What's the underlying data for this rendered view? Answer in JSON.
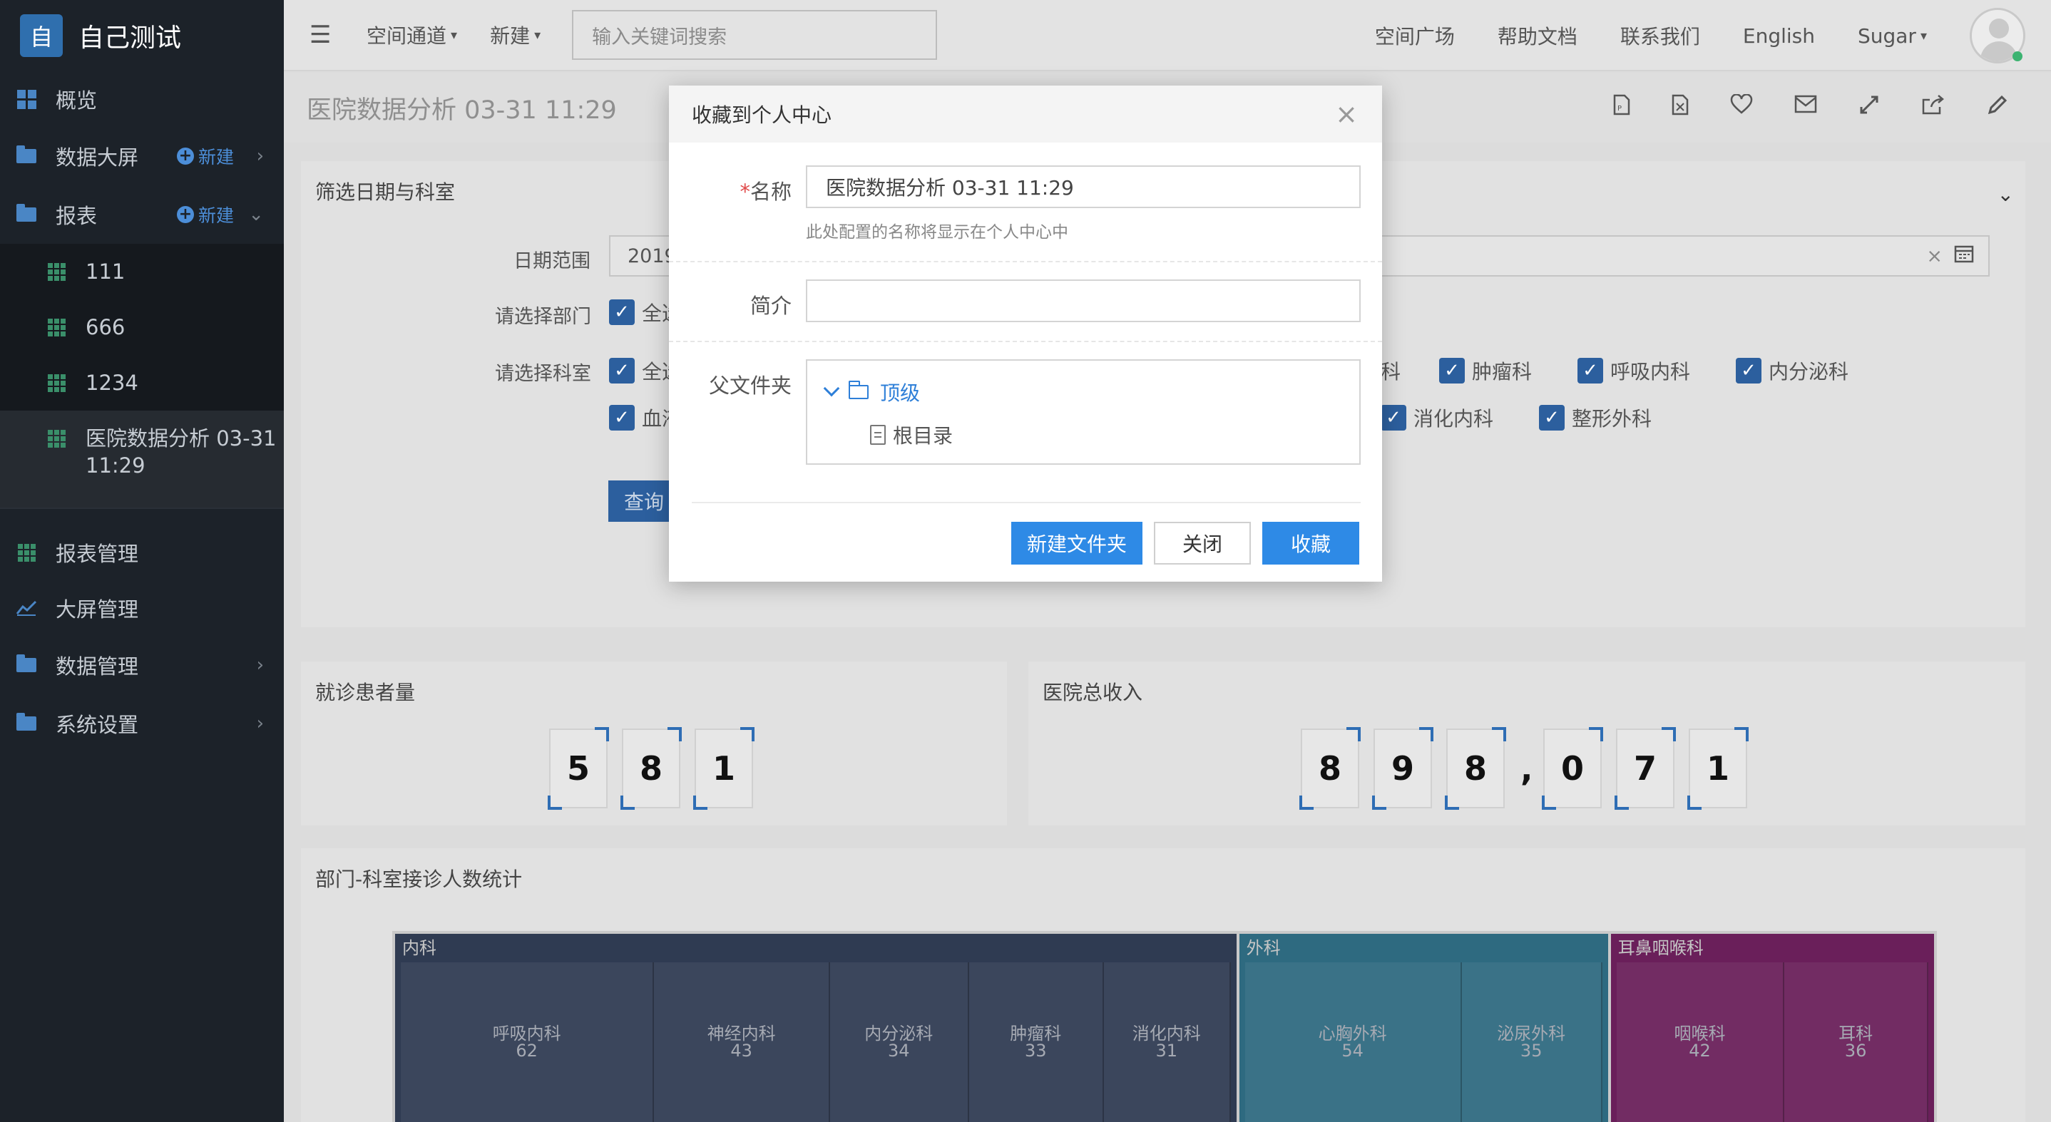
{
  "sidebar": {
    "brand_logo": "自",
    "brand_title": "自己测试",
    "items": [
      {
        "label": "概览",
        "icon": "grid-icon"
      },
      {
        "label": "数据大屏",
        "icon": "folder-icon",
        "new": "新建"
      },
      {
        "label": "报表",
        "icon": "folder-icon",
        "new": "新建"
      },
      {
        "label": "111",
        "icon": "table-icon"
      },
      {
        "label": "666",
        "icon": "table-icon"
      },
      {
        "label": "1234",
        "icon": "table-icon"
      },
      {
        "label": "医院数据分析 03-31 11:29",
        "icon": "table-icon"
      },
      {
        "label": "报表管理",
        "icon": "table-icon"
      },
      {
        "label": "大屏管理",
        "icon": "chart-icon"
      },
      {
        "label": "数据管理",
        "icon": "folder-icon"
      },
      {
        "label": "系统设置",
        "icon": "folder-icon"
      }
    ]
  },
  "topbar": {
    "space_channel": "空间通道",
    "new": "新建",
    "search_placeholder": "输入关键词搜索",
    "links": [
      "空间广场",
      "帮助文档",
      "联系我们",
      "English"
    ],
    "user": "Sugar"
  },
  "page": {
    "title": "医院数据分析 03-31 11:29"
  },
  "filter": {
    "title": "筛选日期与科室",
    "date_label": "日期范围",
    "date_value": "2019",
    "dept_label": "请选择部门",
    "dept_all": "全选",
    "office_label": "请选择科室",
    "office_all": "全选",
    "office_blood": "血液科",
    "offices_right_row1": [
      "科",
      "肿瘤科",
      "呼吸内科",
      "内分泌科"
    ],
    "offices_right_row2": [
      "消化内科",
      "整形外科"
    ],
    "query": "查询"
  },
  "kpi": {
    "patients_title": "就诊患者量",
    "patients_digits": [
      "5",
      "8",
      "1"
    ],
    "revenue_title": "医院总收入",
    "revenue_digits": [
      "8",
      "9",
      "8",
      "0",
      "7",
      "1"
    ]
  },
  "treemap": {
    "title": "部门-科室接诊人数统计",
    "groups": [
      {
        "name": "内科",
        "color": "#2f3b52",
        "children": [
          {
            "name": "呼吸内科",
            "value": 62
          },
          {
            "name": "神经内科",
            "value": 43
          },
          {
            "name": "内分泌科",
            "value": 34
          },
          {
            "name": "肿瘤科",
            "value": 33
          },
          {
            "name": "消化内科",
            "value": 31
          }
        ]
      },
      {
        "name": "外科",
        "color": "#2e6a80",
        "children": [
          {
            "name": "心胸外科",
            "value": 54
          },
          {
            "name": "泌尿外科",
            "value": 35
          }
        ]
      },
      {
        "name": "耳鼻咽喉科",
        "color": "#6a1f5a",
        "children": [
          {
            "name": "咽喉科",
            "value": 42
          },
          {
            "name": "耳科",
            "value": 36
          }
        ]
      }
    ]
  },
  "modal": {
    "title": "收藏到个人中心",
    "name_label": "名称",
    "required_mark": "*",
    "name_value": "医院数据分析  03-31 11:29",
    "name_hint": "此处配置的名称将显示在个人中心中",
    "desc_label": "简介",
    "desc_value": "",
    "folder_label": "父文件夹",
    "tree_root": "顶级",
    "tree_leaf": "根目录",
    "btn_new_folder": "新建文件夹",
    "btn_close": "关闭",
    "btn_collect": "收藏"
  }
}
